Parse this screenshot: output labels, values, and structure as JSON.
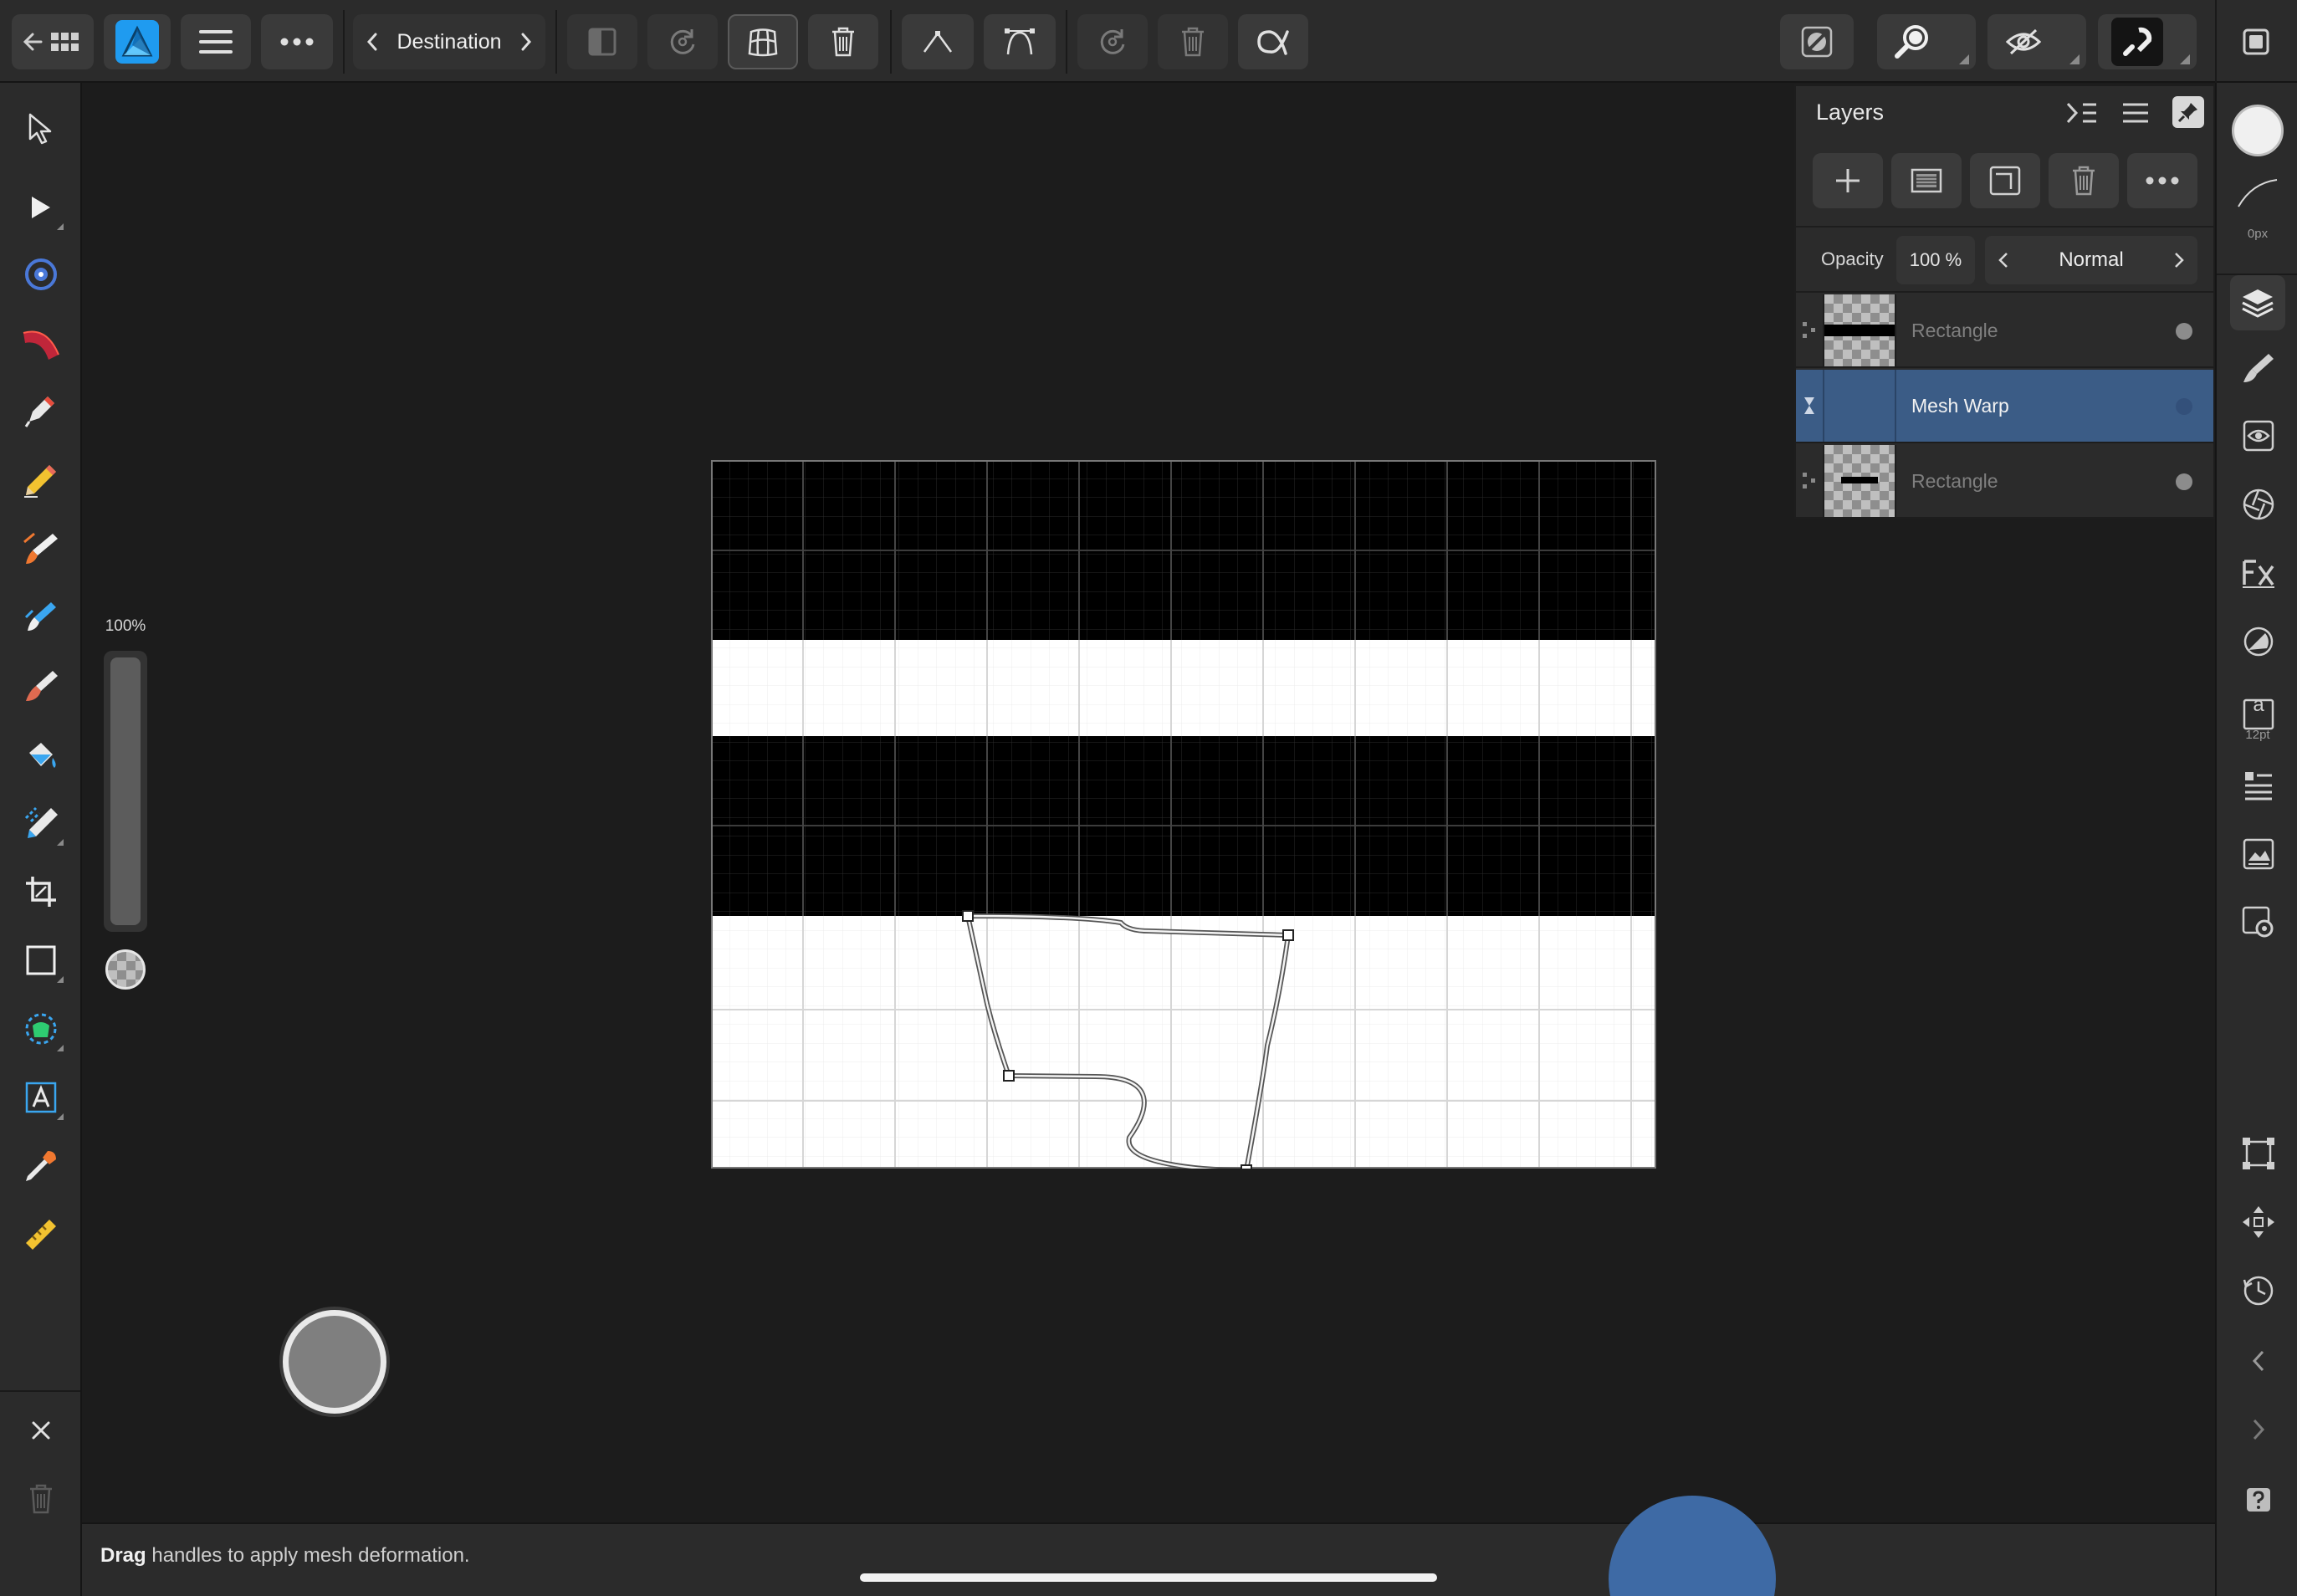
{
  "topbar": {
    "persona_label": "Destination"
  },
  "slider": {
    "label": "100%",
    "fill_fraction": 1.0
  },
  "layers_panel": {
    "title": "Layers",
    "opacity_label": "Opacity",
    "opacity_value": "100 %",
    "blend_mode": "Normal",
    "layers": [
      {
        "name": "Rectangle",
        "selected": false,
        "dimmed": true
      },
      {
        "name": "Mesh Warp",
        "selected": true,
        "dimmed": false
      },
      {
        "name": "Rectangle",
        "selected": false,
        "dimmed": true
      }
    ]
  },
  "right_column": {
    "stroke_width_label": "0px",
    "text_size_label": "12pt",
    "text_icon_letter": "a"
  },
  "status": {
    "bold": "Drag",
    "rest": " handles to apply mesh deformation."
  },
  "colors": {
    "accent_blue": "#3e6aa5",
    "selected_layer": "#3b5c86",
    "affinity_blue": "#1f9bf0",
    "toolbar_bg": "#2b2b2b",
    "canvas_bg": "#1c1c1c"
  }
}
